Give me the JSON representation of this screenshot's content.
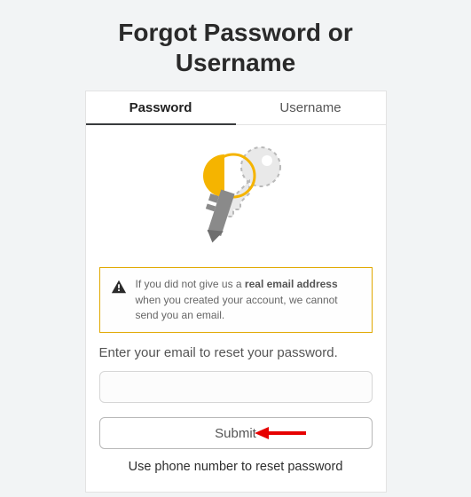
{
  "title": "Forgot Password or Username",
  "tabs": {
    "password": "Password",
    "username": "Username"
  },
  "notice": {
    "prefix": "If you did not give us a ",
    "bold": "real email address",
    "suffix": " when you created your account, we cannot send you an email."
  },
  "prompt": "Enter your email to reset your password.",
  "email_placeholder": "",
  "submit_label": "Submit",
  "phone_link": "Use phone number to reset password"
}
